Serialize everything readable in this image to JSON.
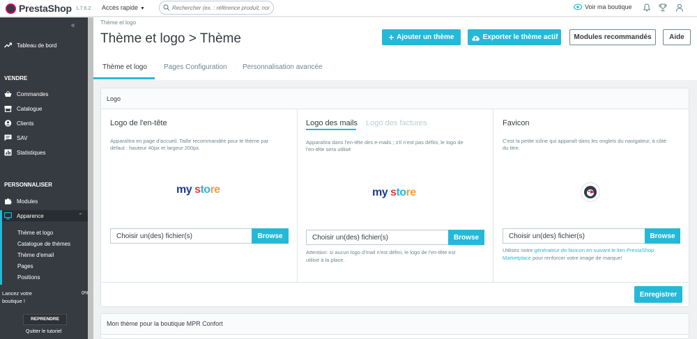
{
  "topbar": {
    "brand": "PrestaShop",
    "version": "1.7.6.2",
    "quick_access": "Accès rapide",
    "search_placeholder": "Rechercher (ex. : référence produit, nom",
    "view_shop": "Voir ma boutique"
  },
  "sidebar": {
    "dashboard": "Tableau de bord",
    "section_sell": "VENDRE",
    "sell_items": [
      "Commandes",
      "Catalogue",
      "Clients",
      "SAV",
      "Statistiques"
    ],
    "section_customize": "PERSONNALISER",
    "modules": "Modules",
    "appearance": "Apparence",
    "appearance_sub": [
      "Thème et logo",
      "Catalogue de thèmes",
      "Thème d'email",
      "Pages",
      "Positions"
    ],
    "promo_text_1": "Lancez votre",
    "promo_text_2": "boutique !",
    "promo_pct": "0%",
    "resume_button": "REPRENDRE",
    "quit_tutorial": "Quitter le tutoriel"
  },
  "header": {
    "breadcrumb": "Thème et logo",
    "title": "Thème et logo > Thème",
    "add_theme": "Ajouter un thème",
    "export_theme": "Exporter le thème actif",
    "recommended_modules": "Modules recommandés",
    "help": "Aide"
  },
  "tabs": [
    "Thème et logo",
    "Pages Configuration",
    "Personnalisation avancée"
  ],
  "logo_panel": {
    "title": "Logo",
    "header_logo": {
      "title": "Logo de l'en-tête",
      "desc_1": "Apparaîtra en page d'accueil. Taille recommandée pour le thème par",
      "desc_2": "défaut : hauteur 40px et largeur 200px.",
      "file_label": "Choisir un(des) fichier(s)",
      "browse": "Browse"
    },
    "mail_logo": {
      "tab_active": "Logo des mails",
      "tab_inactive": "Logo des factures",
      "desc_1": "Apparaîtra dans l'en-tête des e-mails ; s'il n'est pas défini, le logo de",
      "desc_2": "l'en-tête sera utilisé",
      "file_label": "Choisir un(des) fichier(s)",
      "browse": "Browse",
      "note_1": "Attention: si aucun logo d'mail n'est défini, le logo de l'en-tête est",
      "note_2": "utilisé à la place."
    },
    "favicon": {
      "title": "Favicon",
      "desc_1": "C'est la petite icône qui apparaît dans les onglets du navigateur, à côté",
      "desc_2": "du titre.",
      "file_label": "Choisir un(des) fichier(s)",
      "browse": "Browse",
      "note_pre": "Utilisez notre ",
      "note_link_1": "générateur de favicon en suivant le lien PrestaShop",
      "note_link_2": "Marketplace",
      "note_post": " pour renforcer votre image de marque!"
    },
    "logo_text": {
      "a": "my",
      "b": " s",
      "c": "to",
      "d": "re"
    },
    "save": "Enregistrer"
  },
  "theme_panel": {
    "title": "Mon thème pour la boutique MPR Confort"
  },
  "colors": {
    "accent": "#25b9d7",
    "sidebar": "#363a41"
  }
}
